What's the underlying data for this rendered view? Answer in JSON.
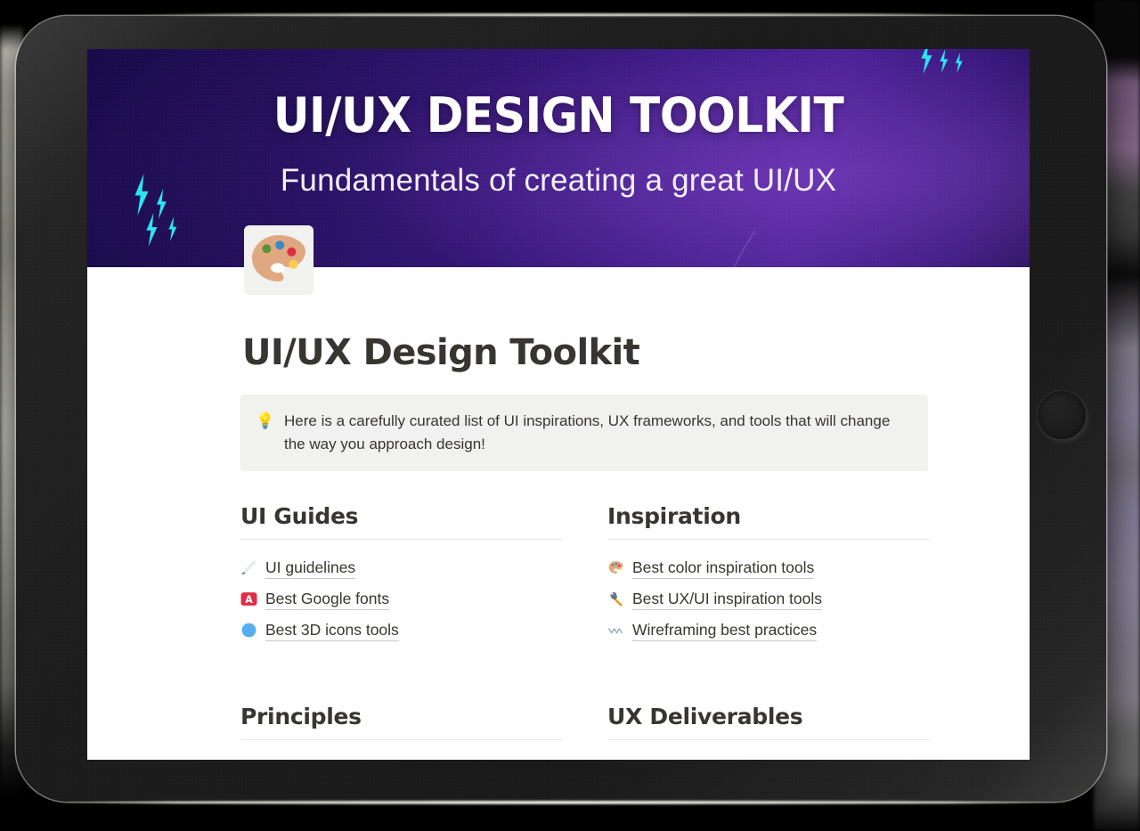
{
  "banner": {
    "title": "UI/UX DESIGN TOOLKIT",
    "subtitle": "Fundamentals of creating a great UI/UX",
    "colors": {
      "dark": "#170942",
      "mid": "#2b1170",
      "light": "#4a1f9c",
      "bolt": "#2ae4f2"
    }
  },
  "page": {
    "icon_name": "artist-palette-icon",
    "title": "UI/UX Design Toolkit"
  },
  "callout": {
    "icon_name": "light-bulb-icon",
    "emoji": "💡",
    "text": "Here is a carefully curated list of UI inspirations, UX frameworks, and tools that will change the way you approach design!"
  },
  "columns": [
    {
      "heading": "UI Guides",
      "links": [
        {
          "icon_name": "paintbrush-icon",
          "label": "UI guidelines"
        },
        {
          "icon_name": "red-a-button-icon",
          "label": "Best Google fonts"
        },
        {
          "icon_name": "blue-circle-icon",
          "label": "Best 3D icons tools"
        }
      ]
    },
    {
      "heading": "Inspiration",
      "links": [
        {
          "icon_name": "artist-palette-icon",
          "label": "Best color inspiration tools"
        },
        {
          "icon_name": "hammer-icon",
          "label": "Best UX/UI inspiration tools"
        },
        {
          "icon_name": "wavy-dash-icon",
          "label": "Wireframing best practices"
        }
      ]
    }
  ],
  "columns_lower": [
    {
      "heading": "Principles"
    },
    {
      "heading": "UX Deliverables"
    }
  ],
  "device": {
    "type": "tablet",
    "bezel_color": "#1c1c1c",
    "home_button_name": "home-button"
  }
}
